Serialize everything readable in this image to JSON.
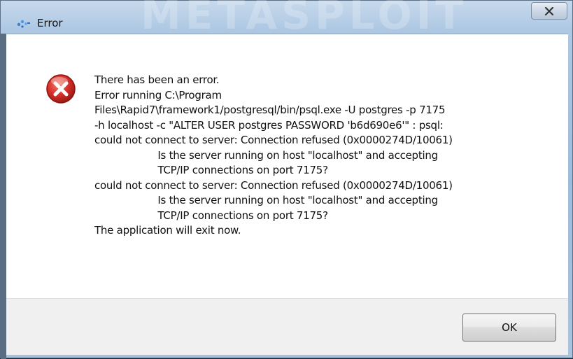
{
  "window": {
    "title": "Error",
    "watermark": "METASPLOIT"
  },
  "dialog": {
    "message": "There has been an error.\nError running C:\\Program\nFiles\\Rapid7\\framework1/postgresql/bin/psql.exe -U postgres -p 7175\n-h localhost -c \"ALTER USER postgres PASSWORD 'b6d690e6'\" : psql:\ncould not connect to server: Connection refused (0x0000274D/10061)\n                    Is the server running on host \"localhost\" and accepting\n                    TCP/IP connections on port 7175?\ncould not connect to server: Connection refused (0x0000274D/10061)\n                    Is the server running on host \"localhost\" and accepting\n                    TCP/IP connections on port 7175?\nThe application will exit now.",
    "ok_label": "OK"
  },
  "icons": {
    "app": "app-icon",
    "error": "error-icon",
    "close": "close-icon"
  },
  "colors": {
    "error_red": "#d32f2f",
    "titlebar": "#aec8e3",
    "footer": "#f0f0f0"
  }
}
